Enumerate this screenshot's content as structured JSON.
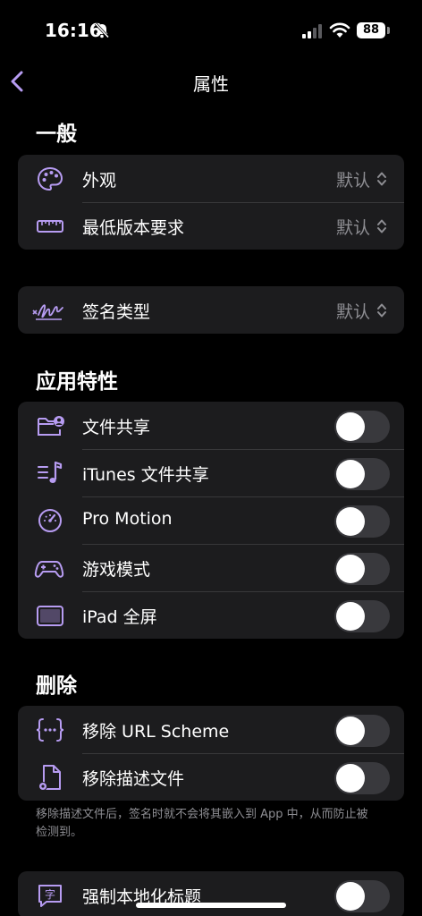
{
  "status": {
    "time": "16:16",
    "battery": "88"
  },
  "nav": {
    "title": "属性"
  },
  "general": {
    "title": "一般",
    "appearance_label": "外观",
    "appearance_value": "默认",
    "min_version_label": "最低版本要求",
    "min_version_value": "默认"
  },
  "signature": {
    "label": "签名类型",
    "value": "默认"
  },
  "features": {
    "title": "应用特性",
    "items": [
      {
        "label": "文件共享",
        "on": false
      },
      {
        "label": "iTunes 文件共享",
        "on": false
      },
      {
        "label": "Pro Motion",
        "on": false
      },
      {
        "label": "游戏模式",
        "on": false
      },
      {
        "label": "iPad 全屏",
        "on": false
      }
    ]
  },
  "remove": {
    "title": "删除",
    "items": [
      {
        "label": "移除 URL Scheme",
        "on": false
      },
      {
        "label": "移除描述文件",
        "on": false
      }
    ],
    "footnote": "移除描述文件后，签名时就不会将其嵌入到 App 中，从而防止被检测到。"
  },
  "localize": {
    "label": "强制本地化标题",
    "on": false
  },
  "colors": {
    "accent": "#b79cf2",
    "cell_bg": "#1c1c1e",
    "toggle_off": "#39393d"
  }
}
